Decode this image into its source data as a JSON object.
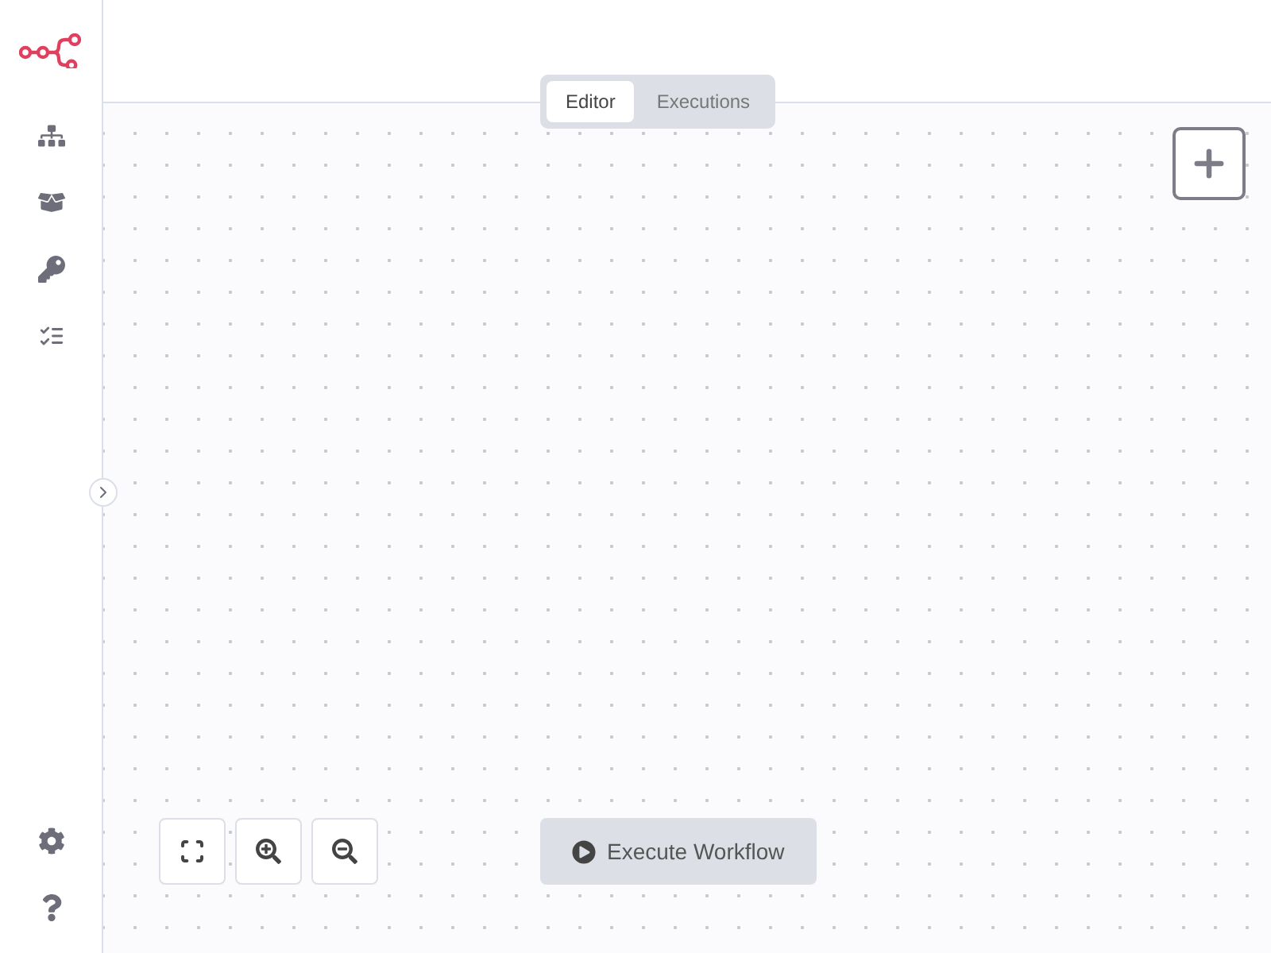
{
  "tabs": [
    {
      "label": "Editor",
      "selected": true
    },
    {
      "label": "Executions",
      "selected": false
    }
  ],
  "execute_button": {
    "label": "Execute Workflow"
  }
}
